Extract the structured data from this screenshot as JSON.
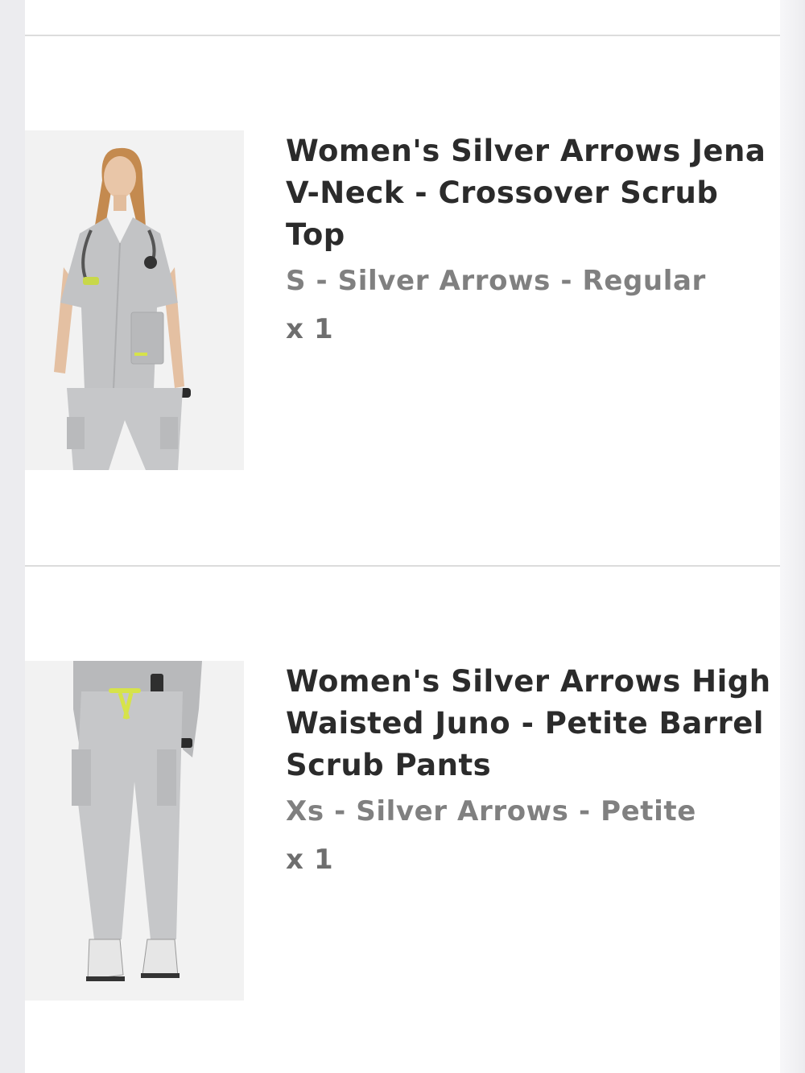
{
  "cart": {
    "items": [
      {
        "title": "Women's Silver Arrows Jena V-Neck - Crossover Scrub Top",
        "variant": "S - Silver Arrows - Regular",
        "quantity": "x 1"
      },
      {
        "title": "Women's Silver Arrows High Waisted Juno - Petite Barrel Scrub Pants",
        "variant": "Xs - Silver Arrows - Petite",
        "quantity": "x 1"
      }
    ]
  },
  "colors": {
    "title": "#2b2b2b",
    "variant": "#808080",
    "sale_accent": "#c0283a",
    "product_grey": "#c4c5c7"
  }
}
